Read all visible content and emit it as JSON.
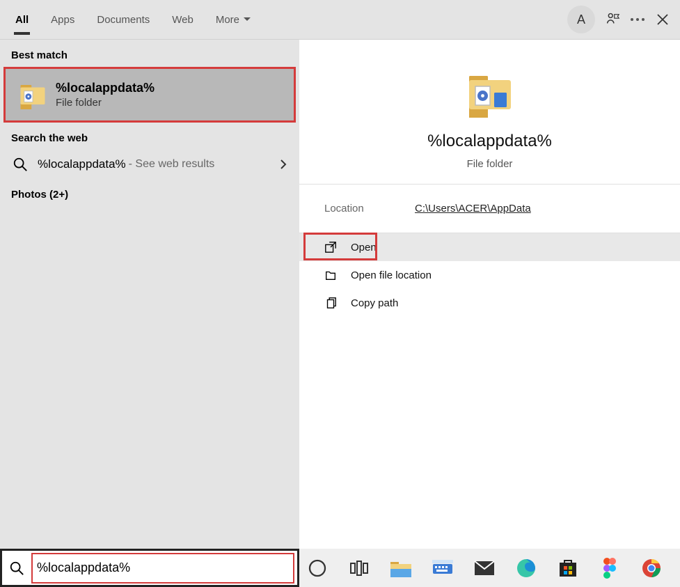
{
  "tabs": [
    "All",
    "Apps",
    "Documents",
    "Web",
    "More"
  ],
  "active_tab": 0,
  "avatar_initial": "A",
  "left": {
    "best_match_label": "Best match",
    "best_match": {
      "title": "%localappdata%",
      "subtitle": "File folder"
    },
    "search_web_label": "Search the web",
    "web": {
      "query": "%localappdata%",
      "suffix": " - See web results"
    },
    "photos_label": "Photos (2+)"
  },
  "right": {
    "title": "%localappdata%",
    "subtitle": "File folder",
    "location_label": "Location",
    "location_value": "C:\\Users\\ACER\\AppData",
    "actions": [
      "Open",
      "Open file location",
      "Copy path"
    ]
  },
  "search_value": "%localappdata%",
  "taskbar_icons": [
    "cortana",
    "task-view",
    "file-explorer",
    "keyboard",
    "mail",
    "edge",
    "store",
    "figma",
    "chrome"
  ]
}
